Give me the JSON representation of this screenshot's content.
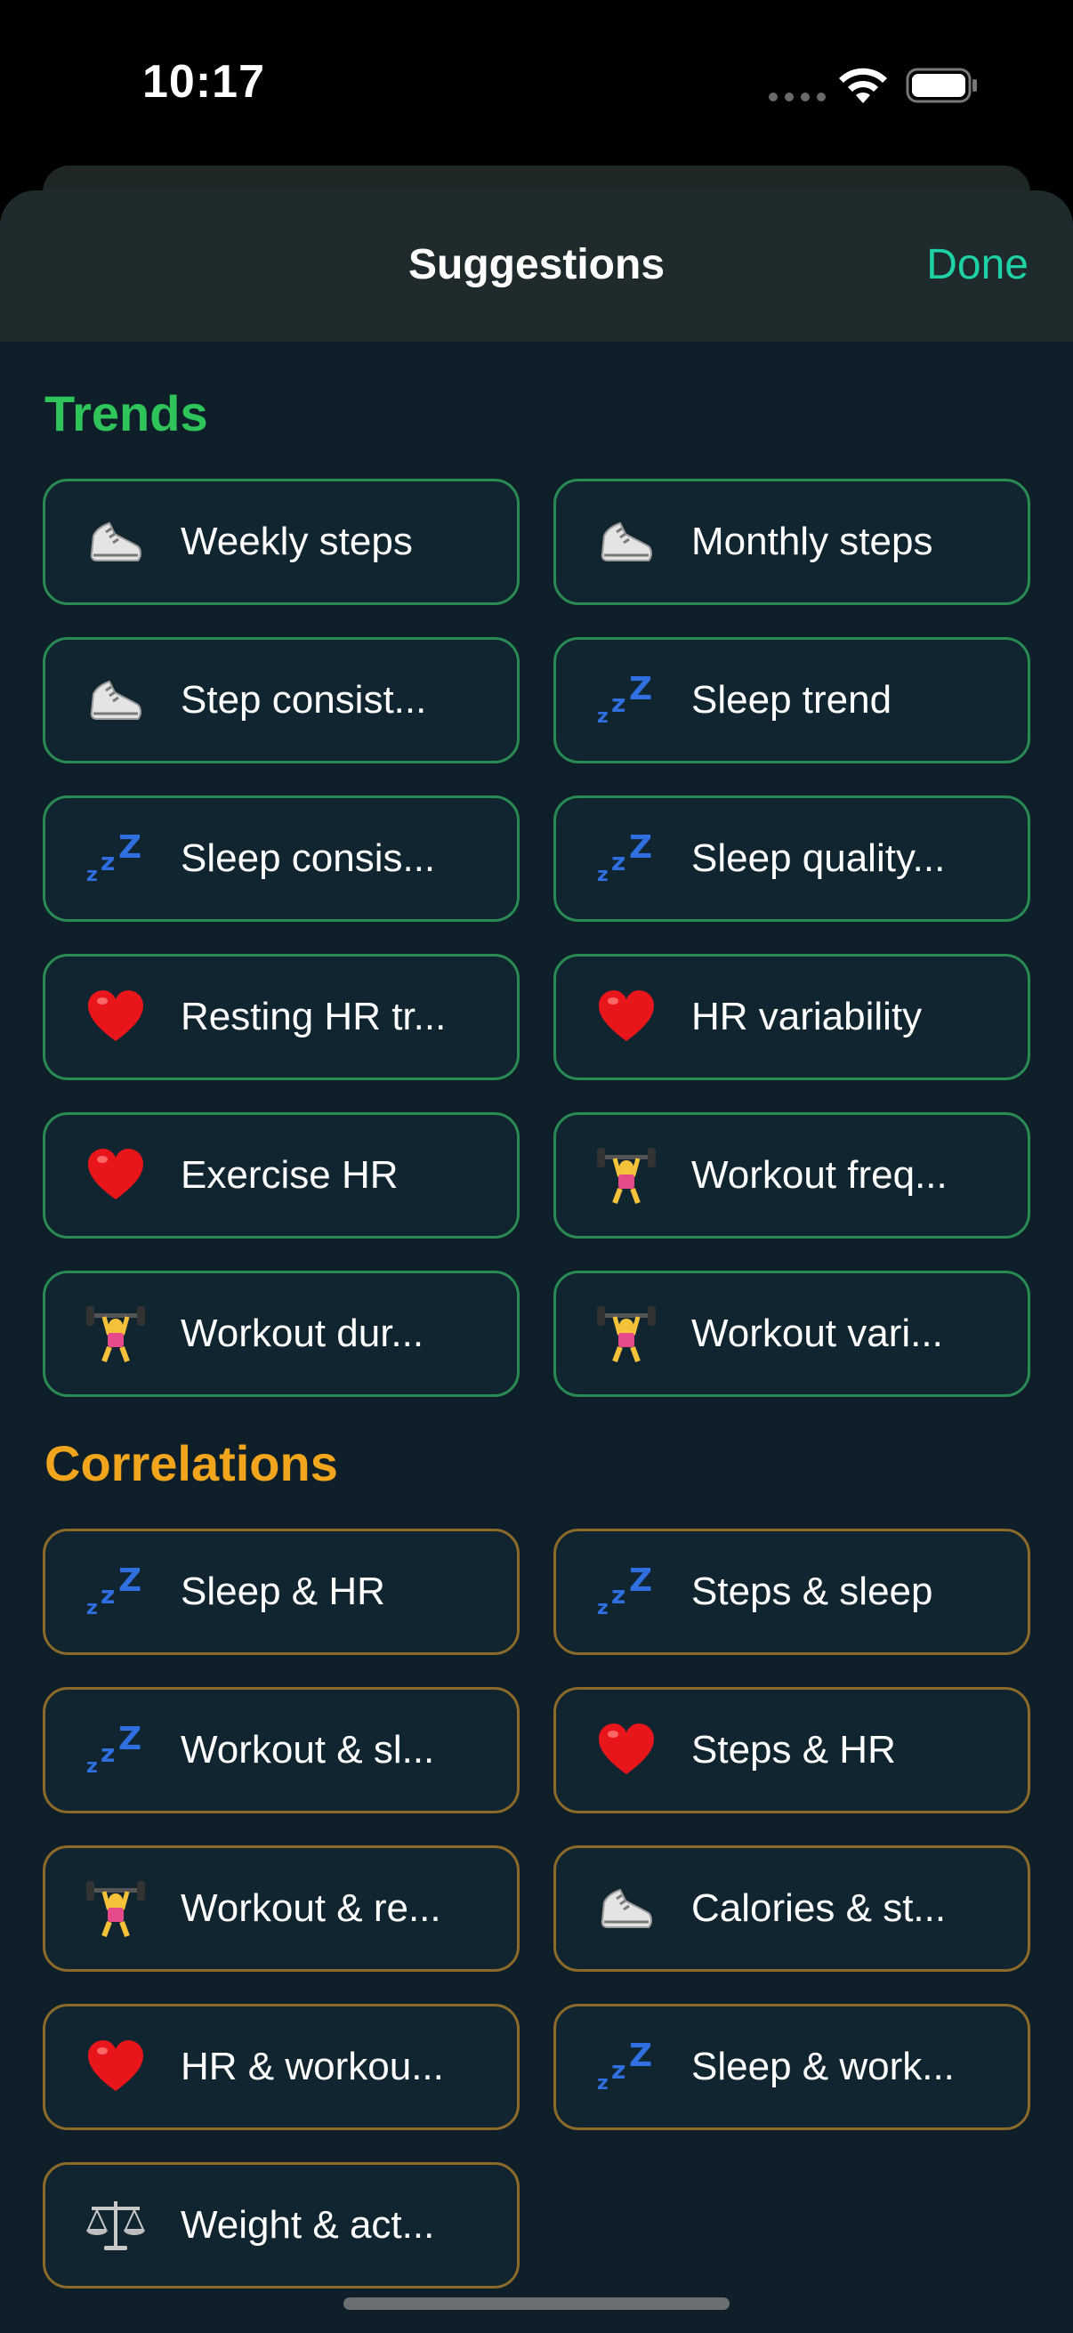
{
  "status_bar": {
    "time": "10:17"
  },
  "sheet": {
    "title": "Suggestions",
    "done_label": "Done"
  },
  "sections": {
    "trends": {
      "title": "Trends",
      "color": "#2fc45a",
      "items": [
        {
          "label": "Weekly steps",
          "icon": "shoe-icon"
        },
        {
          "label": "Monthly steps",
          "icon": "shoe-icon"
        },
        {
          "label": "Step consist...",
          "icon": "shoe-icon"
        },
        {
          "label": "Sleep trend",
          "icon": "zzz-icon"
        },
        {
          "label": "Sleep consis...",
          "icon": "zzz-icon"
        },
        {
          "label": "Sleep quality...",
          "icon": "zzz-icon"
        },
        {
          "label": "Resting HR tr...",
          "icon": "heart-icon"
        },
        {
          "label": "HR variability",
          "icon": "heart-icon"
        },
        {
          "label": "Exercise HR",
          "icon": "heart-icon"
        },
        {
          "label": "Workout freq...",
          "icon": "weightlifter-icon"
        },
        {
          "label": "Workout dur...",
          "icon": "weightlifter-icon"
        },
        {
          "label": "Workout vari...",
          "icon": "weightlifter-icon"
        }
      ]
    },
    "correlations": {
      "title": "Correlations",
      "color": "#f0a51c",
      "items": [
        {
          "label": "Sleep & HR",
          "icon": "zzz-icon"
        },
        {
          "label": "Steps & sleep",
          "icon": "zzz-icon"
        },
        {
          "label": "Workout & sl...",
          "icon": "zzz-icon"
        },
        {
          "label": "Steps & HR",
          "icon": "heart-icon"
        },
        {
          "label": "Workout & re...",
          "icon": "weightlifter-icon"
        },
        {
          "label": "Calories & st...",
          "icon": "shoe-icon"
        },
        {
          "label": "HR & workou...",
          "icon": "heart-icon"
        },
        {
          "label": "Sleep & work...",
          "icon": "zzz-icon"
        },
        {
          "label": "Weight & act...",
          "icon": "scale-icon"
        }
      ]
    }
  }
}
